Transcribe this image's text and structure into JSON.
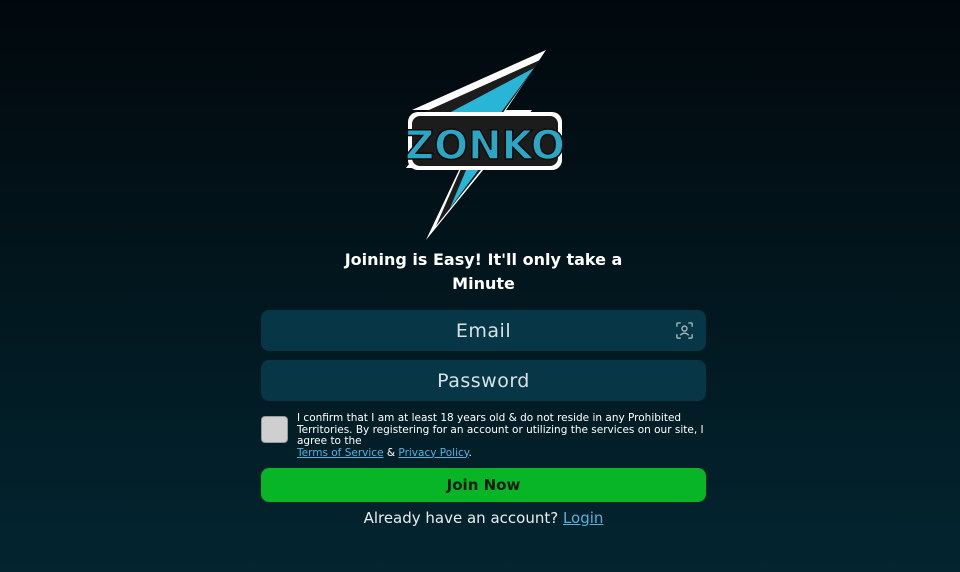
{
  "logo": {
    "text": "ZONKO",
    "icon": "lightning-bolt-icon",
    "colors": {
      "bolt": "#29b6d6",
      "outline": "#ffffff",
      "shadow": "#1c1c1c"
    }
  },
  "headline": {
    "line1": "Joining is Easy! It'll only take a",
    "line2": "Minute"
  },
  "email": {
    "placeholder": "Email",
    "icon": "contact-card-icon"
  },
  "password": {
    "placeholder": "Password"
  },
  "terms": {
    "text1": "I confirm that I am at least 18 years old & do not reside in any Prohibited Territories. By registering for an account or utilizing the services on our site, I agree to the",
    "tos_link": "Terms of Service",
    "amp": "&",
    "privacy_link": "Privacy Policy",
    "end": "."
  },
  "join_button": {
    "label": "Join Now"
  },
  "login": {
    "prompt": "Already have an account?",
    "link": "Login"
  },
  "colors": {
    "background_top": "#01080d",
    "background_bottom": "#032530",
    "field_bg": "#073646",
    "button": "#07b526",
    "link": "#4fb3e0"
  }
}
